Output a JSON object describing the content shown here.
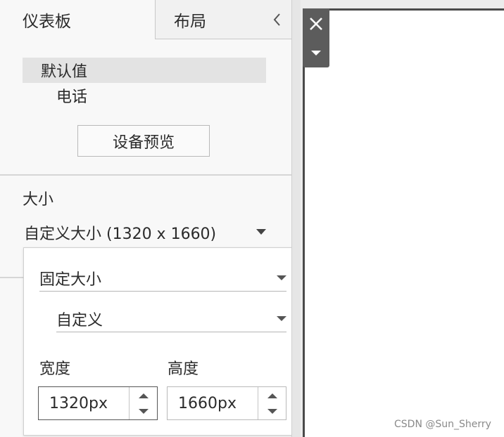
{
  "tabs": {
    "dashboard": "仪表板",
    "layout": "布局"
  },
  "device": {
    "default": "默认值",
    "phone": "电话",
    "preview_button": "设备预览"
  },
  "size": {
    "label": "大小",
    "selected": "自定义大小 (1320 x 1660)",
    "mode": "固定大小",
    "preset": "自定义",
    "width_label": "宽度",
    "width_value": "1320px",
    "height_label": "高度",
    "height_value": "1660px"
  },
  "icons": {
    "collapse": "chevron-left-icon",
    "close": "close-icon",
    "menu": "caret-down-icon"
  },
  "watermark": "CSDN @Sun_Sherry",
  "colors": {
    "toolbar": "#5c5c5c",
    "selected_row": "#e3e3e3",
    "panel": "#f8f8f8"
  }
}
